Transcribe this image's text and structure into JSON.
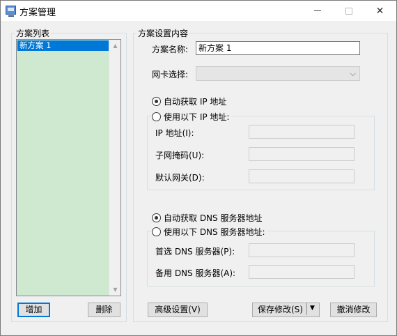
{
  "window": {
    "title": "方案管理",
    "icon": "monitor-icon"
  },
  "scheme_list": {
    "legend": "方案列表",
    "items": [
      "新方案 1"
    ],
    "selected_index": 0,
    "add_label": "增加",
    "delete_label": "删除"
  },
  "settings": {
    "legend": "方案设置内容",
    "name_label": "方案名称:",
    "name_value": "新方案 1",
    "nic_label": "网卡选择:",
    "nic_value": "",
    "ip": {
      "auto_label": "自动获取 IP 地址",
      "manual_label": "使用以下 IP 地址:",
      "auto_selected": true,
      "address_label": "IP  地址(I):",
      "subnet_label": "子网掩码(U):",
      "gateway_label": "默认网关(D):"
    },
    "dns": {
      "auto_label": "自动获取 DNS 服务器地址",
      "manual_label": "使用以下 DNS 服务器地址:",
      "auto_selected": true,
      "preferred_label": "首选 DNS 服务器(P):",
      "alternate_label": "备用 DNS 服务器(A):"
    },
    "advanced_label": "高级设置(V)",
    "save_label": "保存修改(S)",
    "cancel_label": "撤消修改"
  },
  "colors": {
    "selection": "#0078d7",
    "list_bg": "#cfe8d0",
    "default_button_border": "#0078d7"
  }
}
